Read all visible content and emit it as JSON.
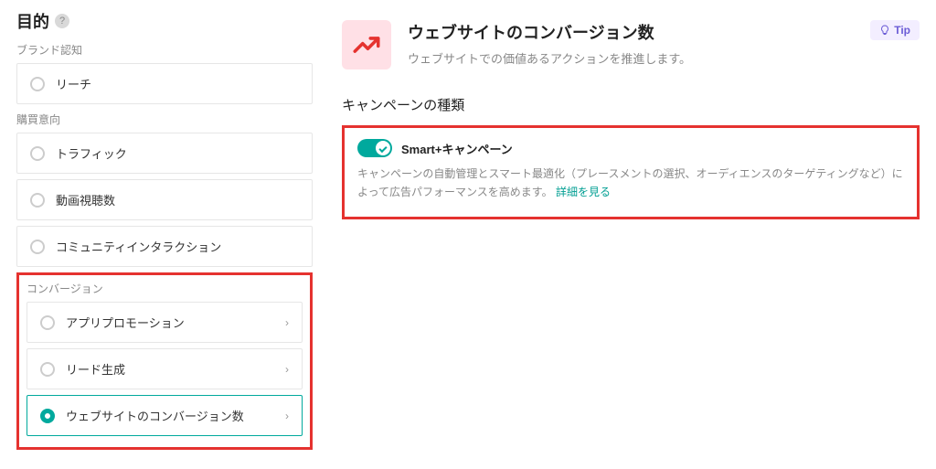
{
  "sidebar": {
    "title": "目的",
    "groups": [
      {
        "label": "ブランド認知",
        "items": [
          {
            "label": "リーチ",
            "hasChevron": false
          }
        ]
      },
      {
        "label": "購買意向",
        "items": [
          {
            "label": "トラフィック",
            "hasChevron": false
          },
          {
            "label": "動画視聴数",
            "hasChevron": false
          },
          {
            "label": "コミュニティインタラクション",
            "hasChevron": false
          }
        ]
      },
      {
        "label": "コンバージョン",
        "highlight": true,
        "items": [
          {
            "label": "アプリプロモーション",
            "hasChevron": true
          },
          {
            "label": "リード生成",
            "hasChevron": true
          },
          {
            "label": "ウェブサイトのコンバージョン数",
            "hasChevron": true,
            "selected": true
          }
        ]
      }
    ]
  },
  "header": {
    "title": "ウェブサイトのコンバージョン数",
    "subtitle": "ウェブサイトでの価値あるアクションを推進します。",
    "tip_label": "Tip"
  },
  "campaign": {
    "heading": "キャンペーンの種類",
    "toggle_label": "Smart+キャンペーン",
    "description": "キャンペーンの自動管理とスマート最適化（プレースメントの選択、オーディエンスのターゲティングなど）によって広告パフォーマンスを高めます。",
    "link_label": "詳細を見る"
  }
}
